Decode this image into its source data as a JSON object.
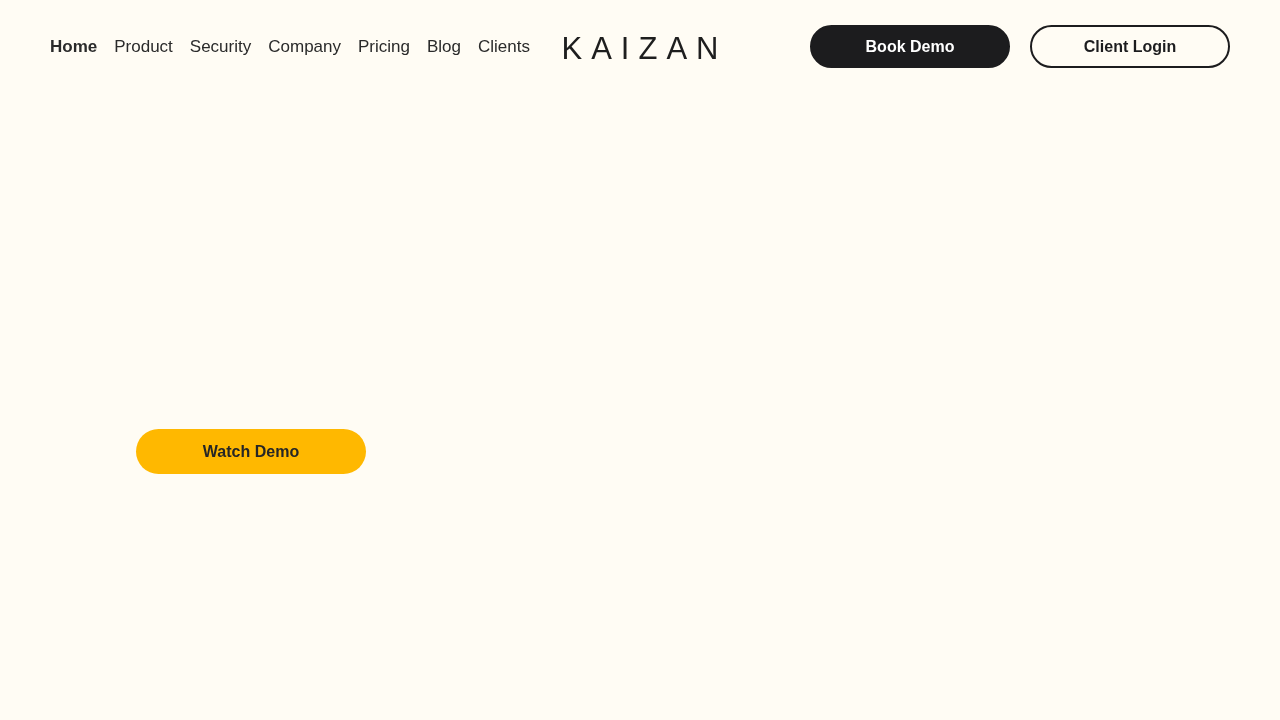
{
  "header": {
    "nav": [
      {
        "label": "Home",
        "selected": true
      },
      {
        "label": "Product",
        "selected": false
      },
      {
        "label": "Security",
        "selected": false
      },
      {
        "label": "Company",
        "selected": false
      },
      {
        "label": "Pricing",
        "selected": false
      },
      {
        "label": "Blog",
        "selected": false
      },
      {
        "label": "Clients",
        "selected": false
      }
    ],
    "logo": "KAIZAN",
    "buttons": [
      {
        "label": "Book Demo",
        "kind": "filled"
      },
      {
        "label": "Client Login",
        "kind": "outline"
      }
    ]
  },
  "hero": {
    "button": "Watch Demo"
  }
}
